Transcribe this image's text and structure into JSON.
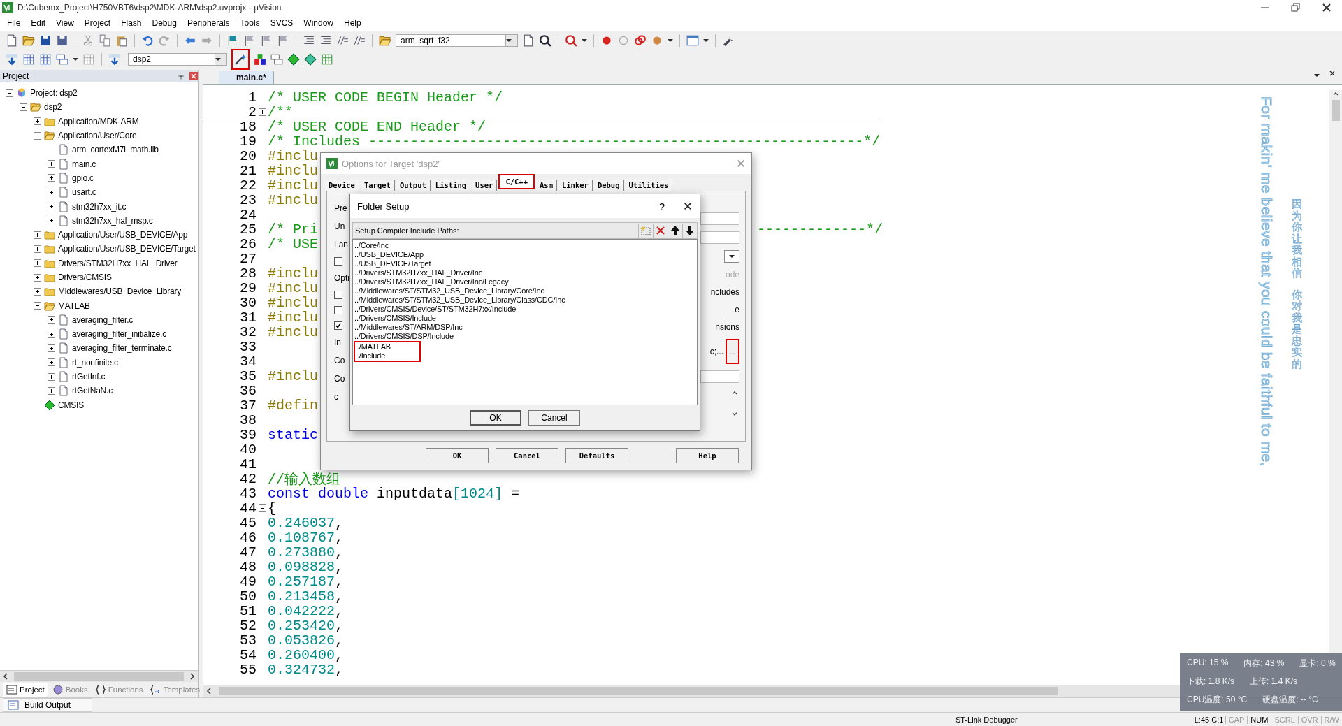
{
  "window": {
    "title": "D:\\Cubemx_Project\\H750VBT6\\dsp2\\MDK-ARM\\dsp2.uvprojx - µVision"
  },
  "menu": [
    "File",
    "Edit",
    "View",
    "Project",
    "Flash",
    "Debug",
    "Peripherals",
    "Tools",
    "SVCS",
    "Window",
    "Help"
  ],
  "toolbar_1": {
    "combo_value": "arm_sqrt_f32"
  },
  "toolbar_2": {
    "target_value": "dsp2",
    "buttons": [
      {
        "highlighted": true
      },
      {
        "highlighted": false
      },
      {
        "highlighted": false
      },
      {
        "highlighted": false
      },
      {
        "highlighted": false
      },
      {
        "highlighted": false
      }
    ]
  },
  "project_panel": {
    "title": "Project",
    "tree": [
      {
        "label": "Project: dsp2",
        "kind": "project",
        "expanded": true,
        "children": [
          {
            "label": "dsp2",
            "kind": "target",
            "expanded": true,
            "children": [
              {
                "label": "Application/MDK-ARM",
                "kind": "group",
                "expanded": false
              },
              {
                "label": "Application/User/Core",
                "kind": "group",
                "expanded": true,
                "children": [
                  {
                    "label": "arm_cortexM7l_math.lib",
                    "kind": "file"
                  },
                  {
                    "label": "main.c",
                    "kind": "file",
                    "expanded": false
                  },
                  {
                    "label": "gpio.c",
                    "kind": "file",
                    "expanded": false
                  },
                  {
                    "label": "usart.c",
                    "kind": "file",
                    "expanded": false
                  },
                  {
                    "label": "stm32h7xx_it.c",
                    "kind": "file",
                    "expanded": false
                  },
                  {
                    "label": "stm32h7xx_hal_msp.c",
                    "kind": "file",
                    "expanded": false
                  }
                ]
              },
              {
                "label": "Application/User/USB_DEVICE/App",
                "kind": "group",
                "expanded": false
              },
              {
                "label": "Application/User/USB_DEVICE/Target",
                "kind": "group",
                "expanded": false
              },
              {
                "label": "Drivers/STM32H7xx_HAL_Driver",
                "kind": "group",
                "expanded": false
              },
              {
                "label": "Drivers/CMSIS",
                "kind": "group",
                "expanded": false
              },
              {
                "label": "Middlewares/USB_Device_Library",
                "kind": "group",
                "expanded": false
              },
              {
                "label": "MATLAB",
                "kind": "group",
                "expanded": true,
                "children": [
                  {
                    "label": "averaging_filter.c",
                    "kind": "file",
                    "expanded": false
                  },
                  {
                    "label": "averaging_filter_initialize.c",
                    "kind": "file",
                    "expanded": false
                  },
                  {
                    "label": "averaging_filter_terminate.c",
                    "kind": "file",
                    "expanded": false
                  },
                  {
                    "label": "rt_nonfinite.c",
                    "kind": "file",
                    "expanded": false
                  },
                  {
                    "label": "rtGetInf.c",
                    "kind": "file",
                    "expanded": false
                  },
                  {
                    "label": "rtGetNaN.c",
                    "kind": "file",
                    "expanded": false
                  }
                ]
              },
              {
                "label": "CMSIS",
                "kind": "component"
              }
            ]
          }
        ]
      }
    ],
    "tabs": [
      {
        "label": "Project",
        "selected": true
      },
      {
        "label": "Books",
        "selected": false
      },
      {
        "label": "Functions",
        "selected": false
      },
      {
        "label": "Templates",
        "selected": false
      }
    ]
  },
  "build_output": {
    "label": "Build Output"
  },
  "editor": {
    "tabs": [
      {
        "label": "main.c*",
        "selected": true
      }
    ],
    "lines": [
      {
        "number": "1",
        "segments": [
          {
            "kind": "comment",
            "text": "/* USER CODE BEGIN Header */"
          }
        ]
      },
      {
        "number": "2",
        "collapsed": true,
        "segments": [
          {
            "kind": "comment",
            "text": "/**"
          }
        ]
      },
      {
        "number": "18",
        "segments": [
          {
            "kind": "comment",
            "text": "/* USER CODE END Header */"
          }
        ]
      },
      {
        "number": "19",
        "segments": [
          {
            "kind": "comment",
            "text": "/* Includes -----------------------------------------------------------*/"
          }
        ]
      },
      {
        "number": "20",
        "segments": [
          {
            "kind": "directive",
            "text": "#inclu"
          }
        ]
      },
      {
        "number": "21",
        "segments": [
          {
            "kind": "directive",
            "text": "#inclu"
          }
        ]
      },
      {
        "number": "22",
        "segments": [
          {
            "kind": "directive",
            "text": "#inclu"
          }
        ]
      },
      {
        "number": "23",
        "segments": [
          {
            "kind": "directive",
            "text": "#inclu"
          }
        ]
      },
      {
        "number": "24"
      },
      {
        "number": "25",
        "segments": [
          {
            "kind": "comment",
            "text": "/* Pri"
          }
        ],
        "tail": "-------------*/"
      },
      {
        "number": "26",
        "segments": [
          {
            "kind": "comment",
            "text": "/* USE"
          }
        ]
      },
      {
        "number": "27"
      },
      {
        "number": "28",
        "segments": [
          {
            "kind": "directive",
            "text": "#inclu"
          }
        ]
      },
      {
        "number": "29",
        "segments": [
          {
            "kind": "directive",
            "text": "#inclu"
          }
        ]
      },
      {
        "number": "30",
        "segments": [
          {
            "kind": "directive",
            "text": "#inclu"
          }
        ]
      },
      {
        "number": "31",
        "segments": [
          {
            "kind": "directive",
            "text": "#inclu"
          }
        ]
      },
      {
        "number": "32",
        "segments": [
          {
            "kind": "directive",
            "text": "#inclu"
          }
        ]
      },
      {
        "number": "33"
      },
      {
        "number": "34"
      },
      {
        "number": "35",
        "segments": [
          {
            "kind": "directive",
            "text": "#inclu"
          }
        ]
      },
      {
        "number": "36"
      },
      {
        "number": "37",
        "segments": [
          {
            "kind": "directive",
            "text": "#defin"
          }
        ]
      },
      {
        "number": "38"
      },
      {
        "number": "39",
        "segments": [
          {
            "kind": "keyword",
            "text": "static"
          }
        ]
      },
      {
        "number": "40"
      },
      {
        "number": "41"
      },
      {
        "number": "42",
        "segments": [
          {
            "kind": "comment",
            "text": "//输入数组"
          }
        ]
      },
      {
        "number": "43",
        "segments": [
          {
            "kind": "keyword",
            "text": "const double"
          },
          {
            "kind": "plain",
            "text": " inputdata"
          },
          {
            "kind": "number",
            "text": "[1024]"
          },
          {
            "kind": "plain",
            "text": " ="
          }
        ]
      },
      {
        "number": "44",
        "collapsed": false,
        "segments": [
          {
            "kind": "plain",
            "text": "{"
          }
        ]
      },
      {
        "number": "45",
        "segments": [
          {
            "kind": "number",
            "text": "0.246037"
          },
          {
            "kind": "plain",
            "text": ","
          }
        ]
      },
      {
        "number": "46",
        "segments": [
          {
            "kind": "number",
            "text": "0.108767"
          },
          {
            "kind": "plain",
            "text": ","
          }
        ]
      },
      {
        "number": "47",
        "segments": [
          {
            "kind": "number",
            "text": "0.273880"
          },
          {
            "kind": "plain",
            "text": ","
          }
        ]
      },
      {
        "number": "48",
        "segments": [
          {
            "kind": "number",
            "text": "0.098828"
          },
          {
            "kind": "plain",
            "text": ","
          }
        ]
      },
      {
        "number": "49",
        "segments": [
          {
            "kind": "number",
            "text": "0.257187"
          },
          {
            "kind": "plain",
            "text": ","
          }
        ]
      },
      {
        "number": "50",
        "segments": [
          {
            "kind": "number",
            "text": "0.213458"
          },
          {
            "kind": "plain",
            "text": ","
          }
        ]
      },
      {
        "number": "51",
        "segments": [
          {
            "kind": "number",
            "text": "0.042222"
          },
          {
            "kind": "plain",
            "text": ","
          }
        ]
      },
      {
        "number": "52",
        "segments": [
          {
            "kind": "number",
            "text": "0.253420"
          },
          {
            "kind": "plain",
            "text": ","
          }
        ]
      },
      {
        "number": "53",
        "segments": [
          {
            "kind": "number",
            "text": "0.053826"
          },
          {
            "kind": "plain",
            "text": ","
          }
        ]
      },
      {
        "number": "54",
        "segments": [
          {
            "kind": "number",
            "text": "0.260400"
          },
          {
            "kind": "plain",
            "text": ","
          }
        ]
      },
      {
        "number": "55",
        "segments": [
          {
            "kind": "number",
            "text": "0.324732"
          },
          {
            "kind": "plain",
            "text": ","
          }
        ]
      }
    ]
  },
  "options_dialog": {
    "title": "Options for Target 'dsp2'",
    "tabs": [
      {
        "label": "Device",
        "selected": false,
        "highlighted": false
      },
      {
        "label": "Target",
        "selected": false,
        "highlighted": false
      },
      {
        "label": "Output",
        "selected": false,
        "highlighted": false
      },
      {
        "label": "Listing",
        "selected": false,
        "highlighted": false
      },
      {
        "label": "User",
        "selected": false,
        "highlighted": false
      },
      {
        "label": "C/C++",
        "selected": true,
        "highlighted": true
      },
      {
        "label": "Asm",
        "selected": false,
        "highlighted": false
      },
      {
        "label": "Linker",
        "selected": false,
        "highlighted": false
      },
      {
        "label": "Debug",
        "selected": false,
        "highlighted": false
      },
      {
        "label": "Utilities",
        "selected": false,
        "highlighted": false
      }
    ],
    "left_fragments": [
      {
        "kind": "label",
        "text": "Pre"
      },
      {
        "kind": "label",
        "text": "Un"
      },
      {
        "kind": "label",
        "text": "Lan"
      },
      {
        "kind": "checkbox",
        "checked": false
      },
      {
        "kind": "label",
        "text": "Opti"
      },
      {
        "kind": "checkbox",
        "checked": false
      },
      {
        "kind": "checkbox",
        "checked": false
      },
      {
        "kind": "checkbox",
        "checked": true
      },
      {
        "kind": "label",
        "text": "In"
      },
      {
        "kind": "label",
        "text": "Co"
      },
      {
        "kind": "label",
        "text": "Co"
      },
      {
        "kind": "label",
        "text": "c"
      }
    ],
    "right_fragments": [
      {
        "kind": "field"
      },
      {
        "kind": "field"
      },
      {
        "kind": "dropdown"
      },
      {
        "kind": "label",
        "text": "ode",
        "disabled": true
      },
      {
        "kind": "label",
        "text": "ncludes",
        "disabled": false
      },
      {
        "kind": "label",
        "text": "e",
        "disabled": false
      },
      {
        "kind": "label",
        "text": "nsions",
        "disabled": false
      },
      {
        "kind": "browse",
        "text": "c;...",
        "button": "...",
        "highlighted": true
      },
      {
        "kind": "field"
      },
      {
        "kind": "scroll"
      }
    ],
    "buttons": [
      "OK",
      "Cancel",
      "Defaults",
      "Help"
    ]
  },
  "folder_dialog": {
    "title": "Folder Setup",
    "help": "?",
    "header": "Setup Compiler Include Paths:",
    "paths": [
      {
        "text": "../Core/Inc",
        "highlighted": false
      },
      {
        "text": "../USB_DEVICE/App",
        "highlighted": false
      },
      {
        "text": "../USB_DEVICE/Target",
        "highlighted": false
      },
      {
        "text": "../Drivers/STM32H7xx_HAL_Driver/Inc",
        "highlighted": false
      },
      {
        "text": "../Drivers/STM32H7xx_HAL_Driver/Inc/Legacy",
        "highlighted": false
      },
      {
        "text": "../Middlewares/ST/STM32_USB_Device_Library/Core/Inc",
        "highlighted": false
      },
      {
        "text": "../Middlewares/ST/STM32_USB_Device_Library/Class/CDC/Inc",
        "highlighted": false
      },
      {
        "text": "../Drivers/CMSIS/Device/ST/STM32H7xx/Include",
        "highlighted": false
      },
      {
        "text": "../Drivers/CMSIS/Include",
        "highlighted": false
      },
      {
        "text": "../Middlewares/ST/ARM/DSP/Inc",
        "highlighted": false
      },
      {
        "text": "../Drivers/CMSIS/DSP/Include",
        "highlighted": false
      },
      {
        "text": "../MATLAB",
        "highlighted": true
      },
      {
        "text": "../Include",
        "highlighted": true
      }
    ],
    "buttons": [
      "OK",
      "Cancel"
    ]
  },
  "status_bar": {
    "debugger": "ST-Link Debugger",
    "position": "L:45 C:1",
    "indicators": [
      {
        "label": "CAP",
        "on": false
      },
      {
        "label": "NUM",
        "on": true
      },
      {
        "label": "SCRL",
        "on": false
      },
      {
        "label": "OVR",
        "on": false
      },
      {
        "label": "R/W",
        "on": false
      }
    ]
  },
  "lyrics": {
    "english": "For makin' me believe that you could be faithful to me,",
    "chinese": [
      "因为你让我相信",
      "你对我是忠实的"
    ]
  },
  "monitor": {
    "rows": [
      [
        "CPU: 15 %",
        "内存: 43 %",
        "显卡: 0 %"
      ],
      [
        "下载: 1.8 K/s",
        "上传: 1.4 K/s"
      ],
      [
        "CPU温度: 50 °C",
        "硬盘温度: -- °C"
      ]
    ]
  }
}
